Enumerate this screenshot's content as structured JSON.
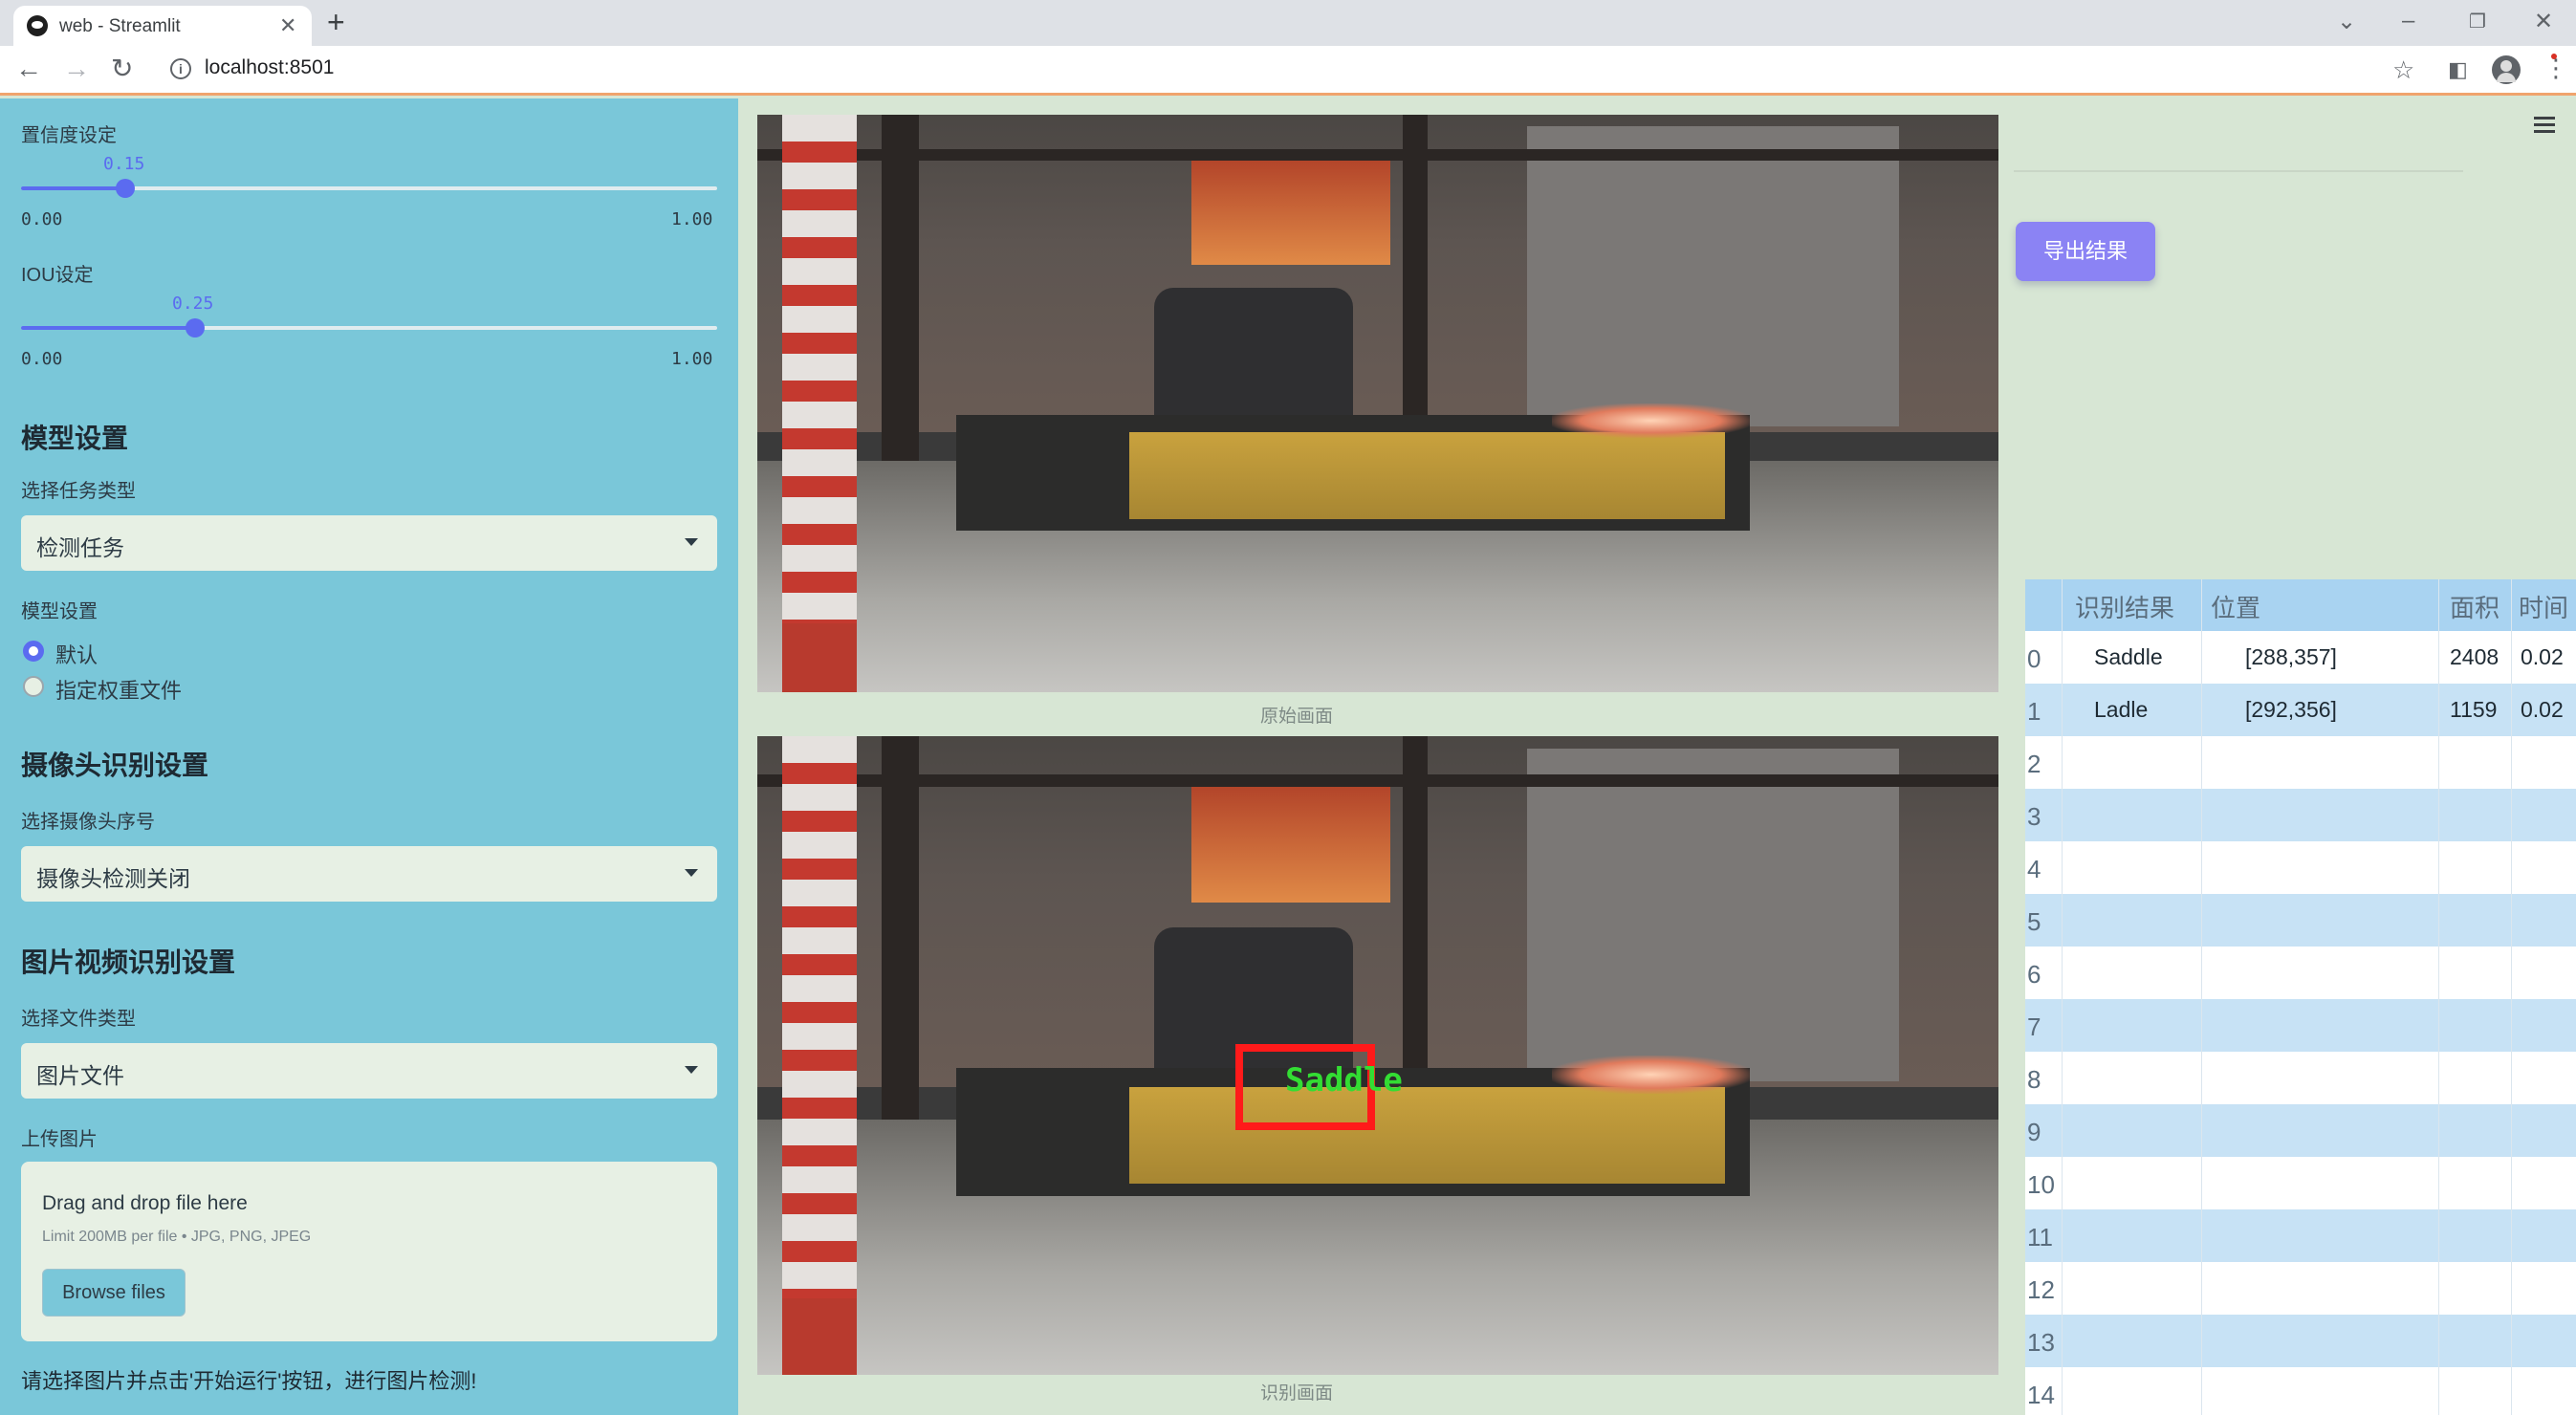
{
  "browser": {
    "tab_title": "web - Streamlit",
    "url": "localhost:8501"
  },
  "sidebar": {
    "confidence": {
      "label": "置信度设定",
      "value_text": "0.15",
      "value": 0.15,
      "min": "0.00",
      "max": "1.00"
    },
    "iou": {
      "label": "IOU设定",
      "value_text": "0.25",
      "value": 0.25,
      "min": "0.00",
      "max": "1.00"
    },
    "model_section": {
      "heading": "模型设置",
      "task_label": "选择任务类型",
      "task_value": "检测任务",
      "model_label": "模型设置",
      "radio_default": "默认",
      "radio_custom": "指定权重文件"
    },
    "camera_section": {
      "heading": "摄像头识别设置",
      "select_label": "选择摄像头序号",
      "select_value": "摄像头检测关闭"
    },
    "media_section": {
      "heading": "图片视频识别设置",
      "filetype_label": "选择文件类型",
      "filetype_value": "图片文件",
      "upload_label": "上传图片",
      "drop_text": "Drag and drop file here",
      "limit_text": "Limit 200MB per file • JPG, PNG, JPEG",
      "browse_label": "Browse files"
    },
    "hint": "请选择图片并点击'开始运行'按钮，进行图片检测!"
  },
  "main": {
    "original_caption": "原始画面",
    "result_caption": "识别画面",
    "detection_label": "Saddle",
    "export_label": "导出结果"
  },
  "table": {
    "headers": [
      "识别结果",
      "位置",
      "面积",
      "时间"
    ],
    "rows": [
      {
        "idx": "0",
        "result": "Saddle",
        "pos": "[288,357]",
        "area": "2408",
        "time": "0.02"
      },
      {
        "idx": "1",
        "result": "Ladle",
        "pos": "[292,356]",
        "area": "1159",
        "time": "0.02"
      },
      {
        "idx": "2"
      },
      {
        "idx": "3"
      },
      {
        "idx": "4"
      },
      {
        "idx": "5"
      },
      {
        "idx": "6"
      },
      {
        "idx": "7"
      },
      {
        "idx": "8"
      },
      {
        "idx": "9"
      },
      {
        "idx": "10"
      },
      {
        "idx": "11"
      },
      {
        "idx": "12"
      },
      {
        "idx": "13"
      },
      {
        "idx": "14"
      }
    ]
  },
  "colors": {
    "sidebar_bg": "#7ac7d9",
    "main_bg": "#d7e6d4",
    "accent": "#5b6bf0",
    "export_btn": "#8b83f4",
    "detection_box": "#ff1a1a",
    "detection_text": "#33dd33"
  },
  "icons": [
    "streamlit-favicon",
    "close-icon",
    "plus-icon",
    "back-arrow-icon",
    "forward-arrow-icon",
    "reload-icon",
    "info-icon",
    "star-icon",
    "side-panel-icon",
    "profile-icon",
    "kebab-menu-icon",
    "hamburger-menu-icon",
    "chevron-down-icon"
  ]
}
